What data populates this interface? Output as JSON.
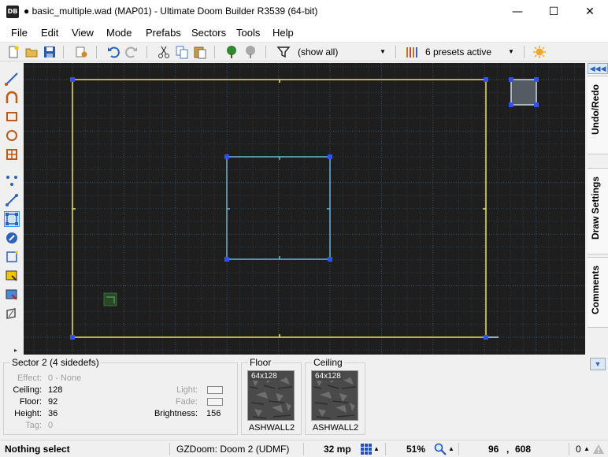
{
  "window": {
    "icon_text": "DB",
    "title": "● basic_multiple.wad (MAP01) - Ultimate Doom Builder R3539 (64-bit)",
    "minimize": "—",
    "maximize": "☐",
    "close": "✕"
  },
  "menu": [
    "File",
    "Edit",
    "View",
    "Mode",
    "Prefabs",
    "Sectors",
    "Tools",
    "Help"
  ],
  "toolbar": {
    "filter_value": "(show all)",
    "presets_value": "6 presets active"
  },
  "colors": {
    "canvas_bg": "#1e1e1e",
    "grid": "#2b3a47",
    "grid_major": "#3a5068",
    "line_yellow": "#e6e65a",
    "line_selected": "#62b6d6",
    "vertex": "#1a3cff",
    "vertex_fill": "#3050ff"
  },
  "right_dock": {
    "tabs": [
      "Undo/Redo",
      "Draw Settings",
      "Comments"
    ]
  },
  "sector_info": {
    "title": "Sector 2 (4 sidedefs)",
    "effect_label": "Effect:",
    "effect_value": "0 - None",
    "ceiling_label": "Ceiling:",
    "ceiling_value": "128",
    "floor_label": "Floor:",
    "floor_value": "92",
    "height_label": "Height:",
    "height_value": "36",
    "tag_label": "Tag:",
    "tag_value": "0",
    "light_label": "Light:",
    "fade_label": "Fade:",
    "brightness_label": "Brightness:",
    "brightness_value": "156"
  },
  "floor_panel": {
    "title": "Floor",
    "size": "64x128",
    "texture": "ASHWALL2"
  },
  "ceiling_panel": {
    "title": "Ceiling",
    "size": "64x128",
    "texture": "ASHWALL2"
  },
  "status": {
    "message": "Nothing select",
    "engine": "GZDoom: Doom 2 (UDMF)",
    "grid": "32 mp",
    "zoom": "51%",
    "coord_x": "96",
    "coord_sep": ",",
    "coord_y": "608",
    "count": "0"
  }
}
